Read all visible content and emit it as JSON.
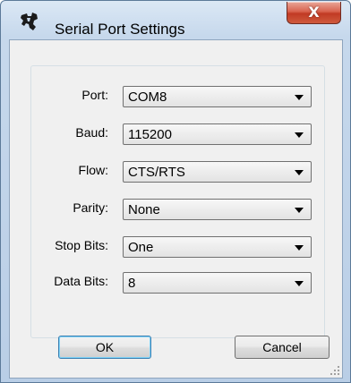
{
  "window": {
    "title": "Serial Port Settings",
    "close_label": "X"
  },
  "fields": [
    {
      "label": "Port:",
      "value": "COM8"
    },
    {
      "label": "Baud:",
      "value": "115200"
    },
    {
      "label": "Flow:",
      "value": "CTS/RTS"
    },
    {
      "label": "Parity:",
      "value": "None"
    },
    {
      "label": "Stop Bits:",
      "value": "One"
    },
    {
      "label": "Data Bits:",
      "value": "8"
    }
  ],
  "buttons": {
    "ok": "OK",
    "cancel": "Cancel"
  },
  "colors": {
    "title_bar": "#c6d8ec",
    "close_button": "#c13a24",
    "client_bg": "#f0f0f0",
    "default_button_border": "#3c7fb1"
  },
  "icons": {
    "app": "texas-instruments-logo-icon",
    "dropdown": "chevron-down-icon",
    "resize": "resize-grip-icon"
  }
}
